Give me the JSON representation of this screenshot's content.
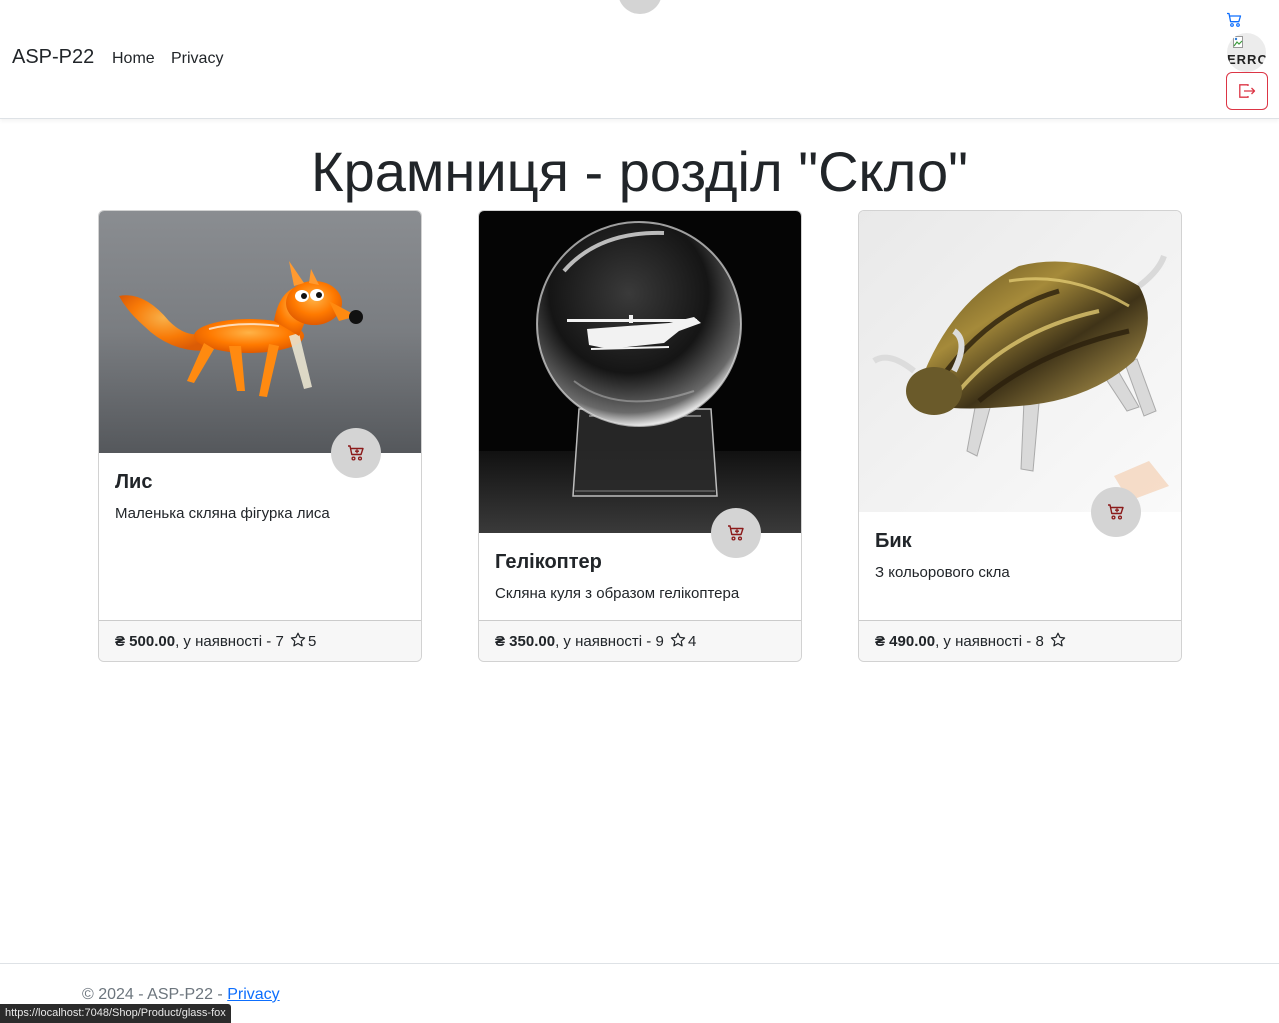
{
  "navbar": {
    "brand": "ASP-P22",
    "links": [
      {
        "label": "Home"
      },
      {
        "label": "Privacy"
      }
    ],
    "avatar_alt": "ERROR",
    "accent_color": "#0d6efd",
    "logout_color": "#dc3545"
  },
  "page": {
    "title": "Крамниця - розділ \"Скло\""
  },
  "products": [
    {
      "name": "Лис",
      "description": "Маленька скляна фігурка лиса",
      "price": "₴ 500.00",
      "stock_text": ", у наявності - 7",
      "rating": "5",
      "image": "glass-fox"
    },
    {
      "name": "Гелікоптер",
      "description": "Скляна куля з образом гелікоптера",
      "price": "₴ 350.00",
      "stock_text": ", у наявності - 9",
      "rating": "4",
      "image": "crystal-ball-helicopter"
    },
    {
      "name": "Бик",
      "description": "З кольорового скла",
      "price": "₴ 490.00",
      "stock_text": ", у наявності - 8",
      "rating": "",
      "image": "glass-bull"
    }
  ],
  "footer": {
    "copyright": "© 2024 - ASP-P22 - ",
    "privacy_link": "Privacy"
  },
  "status_bar": {
    "url": "https://localhost:7048/Shop/Product/glass-fox"
  },
  "colors": {
    "cart_icon": "#8b1a1a",
    "cart_button_bg": "#d4d4d4",
    "footer_bg": "#f7f7f7"
  }
}
